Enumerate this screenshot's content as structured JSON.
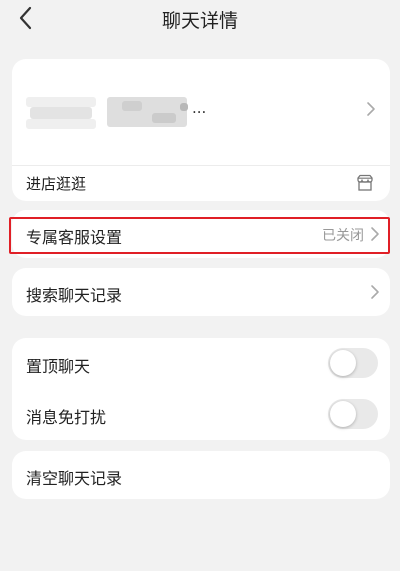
{
  "header": {
    "title": "聊天详情",
    "back_icon": "chevron-left-icon"
  },
  "shop": {
    "name_suffix": "...",
    "enter_label": "进店逛逛",
    "store_icon": "store-icon"
  },
  "service": {
    "label": "专属客服设置",
    "status": "已关闭"
  },
  "search": {
    "label": "搜索聊天记录"
  },
  "settings": {
    "pin_label": "置顶聊天",
    "pin_on": false,
    "dnd_label": "消息免打扰",
    "dnd_on": false
  },
  "clear": {
    "label": "清空聊天记录"
  },
  "colors": {
    "background": "#f2f2f2",
    "card": "#ffffff",
    "highlight": "#e01f26",
    "muted_text": "#999999"
  }
}
